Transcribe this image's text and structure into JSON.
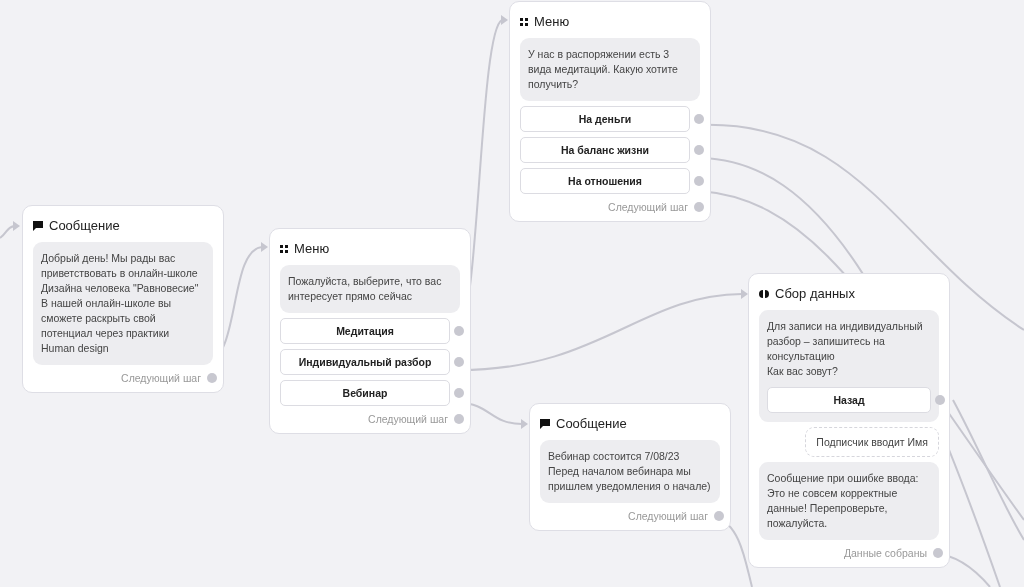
{
  "nodes": [
    {
      "kind": "message",
      "title": "Сообщение",
      "text": "Добрый день! Мы рады вас приветствовать в онлайн-школе Дизайна человека \"Равновесие\"\nВ нашей онлайн-школе вы сможете раскрыть свой потенциал через практики Human design",
      "footer": "Следующий шаг"
    },
    {
      "kind": "menu",
      "title": "Меню",
      "text": "Пожалуйста, выберите, что вас интересует прямо сейчас",
      "buttons": [
        "Медитация",
        "Индивидуальный разбор",
        "Вебинар"
      ],
      "footer": "Следующий шаг"
    },
    {
      "kind": "menu",
      "title": "Меню",
      "text": "У нас в распоряжении есть 3 вида медитаций. Какую хотите получить?",
      "buttons": [
        "На деньги",
        "На баланс жизни",
        "На отношения"
      ],
      "footer": "Следующий шаг"
    },
    {
      "kind": "message",
      "title": "Сообщение",
      "text": "Вебинар состоится 7/08/23\nПеред началом вебинара мы пришлем уведомления о начале)",
      "footer": "Следующий шаг"
    },
    {
      "kind": "data",
      "title": "Сбор данных",
      "text": "Для записи на индивидуальный разбор – запишитесь на консультацию\nКак вас зовут?",
      "inner_button": "Назад",
      "input": "Подписчик вводит Имя",
      "error_text": "Сообщение при ошибке ввода:\nЭто не совсем корректные данные! Перепроверьте, пожалуйста.",
      "footer": "Данные собраны"
    }
  ]
}
